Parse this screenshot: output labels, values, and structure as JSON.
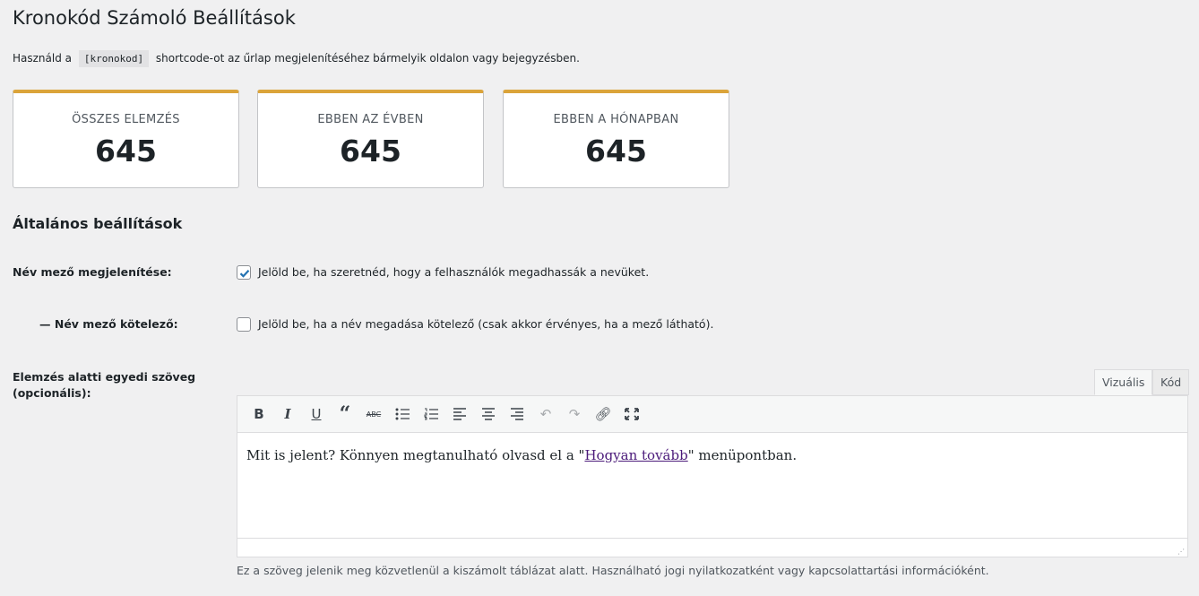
{
  "title": "Kronokód Számoló Beállítások",
  "description": {
    "before": "Használd a",
    "code": "[kronokod]",
    "after": "shortcode-ot az űrlap megjelenítéséhez bármelyik oldalon vagy bejegyzésben."
  },
  "stats": [
    {
      "label": "ÖSSZES ELEMZÉS",
      "value": "645"
    },
    {
      "label": "EBBEN AZ ÉVBEN",
      "value": "645"
    },
    {
      "label": "EBBEN A HÓNAPBAN",
      "value": "645"
    }
  ],
  "accent": "#dba43a",
  "section_title": "Általános beállítások",
  "fields": {
    "show_name": {
      "label": "Név mező megjelenítése:",
      "text": "Jelöld be, ha szeretnéd, hogy a felhasználók megadhassák a nevüket.",
      "checked": true
    },
    "name_required": {
      "label": "— Név mező kötelező:",
      "text": "Jelöld be, ha a név megadása kötelező (csak akkor érvényes, ha a mező látható).",
      "checked": false
    },
    "custom_text": {
      "label_line1": "Elemzés alatti egyedi szöveg",
      "label_line2": "(opcionális):"
    }
  },
  "editor": {
    "tabs": [
      "Vizuális",
      "Kód"
    ],
    "content_before": "Mit is jelent? Könnyen megtanulható olvasd el a \"",
    "link_text": "Hogyan tovább",
    "content_after": "\" menüpontban.",
    "help": "Ez a szöveg jelenik meg közvetlenül a kiszámolt táblázat alatt. Használható jogi nyilatkozatként vagy kapcsolattartási információként."
  }
}
